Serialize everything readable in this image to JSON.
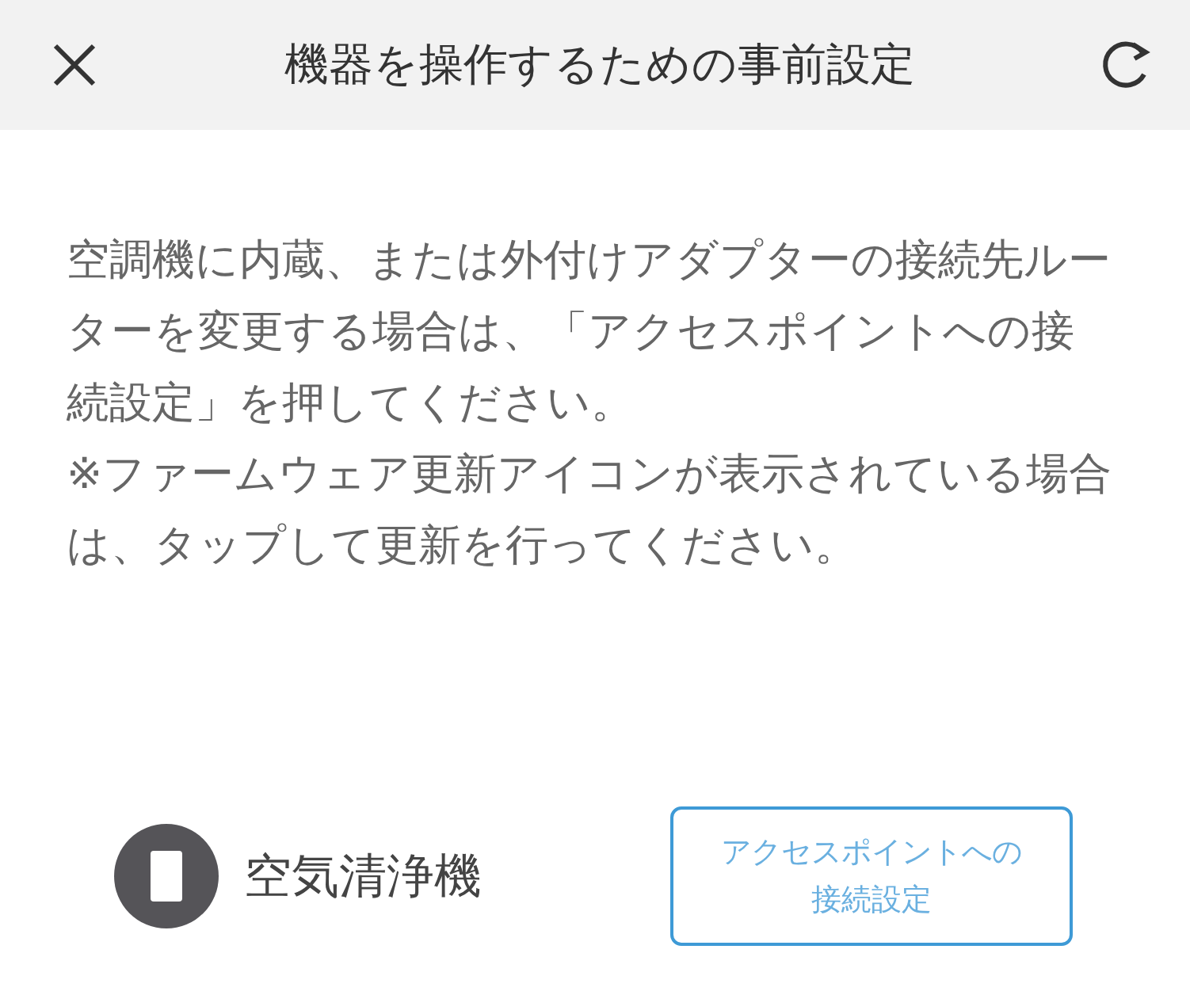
{
  "header": {
    "title": "機器を操作するための事前設定"
  },
  "paragraphs": [
    "空調機に内蔵、または外付けアダプターの接続先ルーターを変更する場合は、「アクセスポイントへの接続設定」を押してください。",
    "※ファームウェア更新アイコンが表示されている場合は、タップして更新を行ってください。"
  ],
  "device": {
    "name": "空気清浄機",
    "button_lines": [
      "アクセスポイントへの",
      "接続設定"
    ]
  }
}
